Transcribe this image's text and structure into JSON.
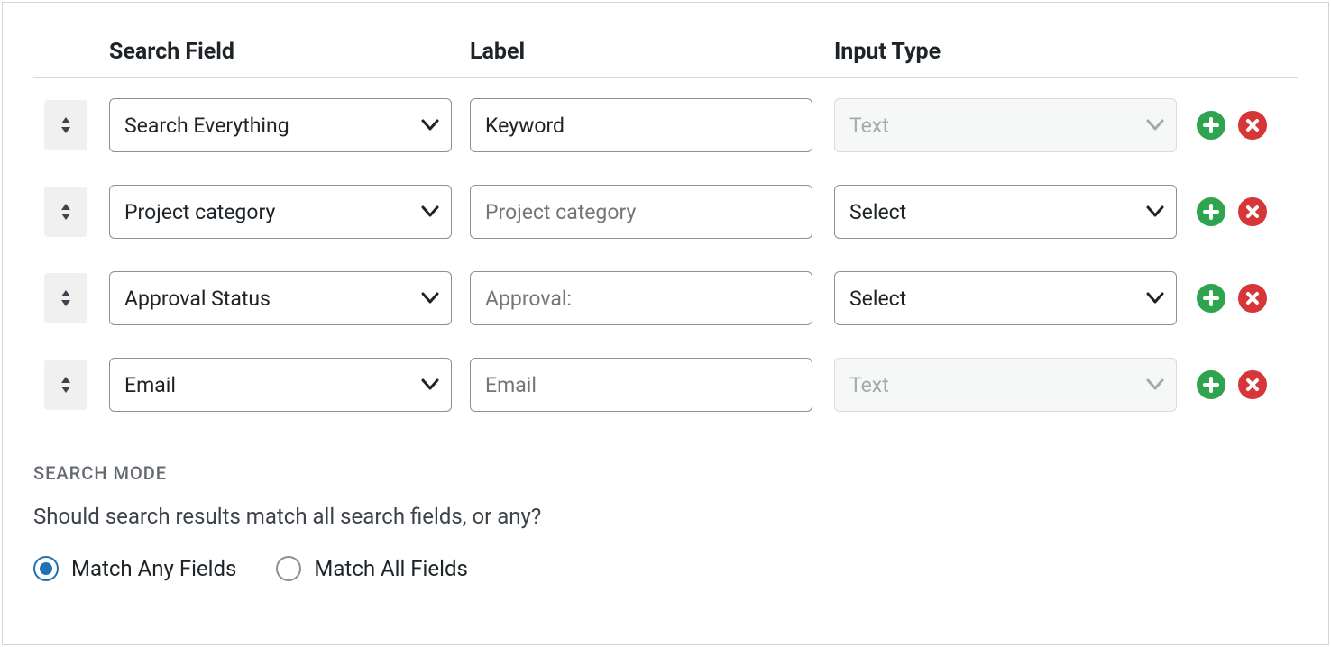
{
  "headers": {
    "field": "Search Field",
    "label": "Label",
    "type": "Input Type"
  },
  "rows": [
    {
      "field": "Search Everything",
      "label_value": "Keyword",
      "label_placeholder": "",
      "type": "Text",
      "type_disabled": true
    },
    {
      "field": "Project category",
      "label_value": "",
      "label_placeholder": "Project category",
      "type": "Select",
      "type_disabled": false
    },
    {
      "field": "Approval Status",
      "label_value": "",
      "label_placeholder": "Approval:",
      "type": "Select",
      "type_disabled": false
    },
    {
      "field": "Email",
      "label_value": "",
      "label_placeholder": "Email",
      "type": "Text",
      "type_disabled": true
    }
  ],
  "mode": {
    "title": "SEARCH MODE",
    "description": "Should search results match all search fields, or any?",
    "options": {
      "any": "Match Any Fields",
      "all": "Match All Fields"
    },
    "selected": "any"
  }
}
